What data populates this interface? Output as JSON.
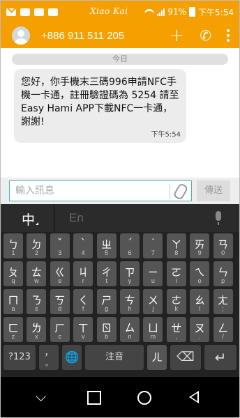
{
  "status": {
    "watermark": "Xiao Kai",
    "battery": "91%",
    "time": "下午5:54",
    "icons": [
      "mail-icon",
      "image-icon",
      "keyboard-icon",
      "image-icon"
    ]
  },
  "appbar": {
    "contact": "+886 911 511 205",
    "color": "#f5a000",
    "icons": [
      "avatar-icon",
      "plus-icon",
      "phone-icon",
      "more-vert-icon"
    ]
  },
  "chat": {
    "day_label": "今日",
    "message": "您好，你手機末三碼996申請NFC手機一卡通，註冊驗證碼為 5254 請至Easy Hami  APP下載NFC一卡通，謝謝!",
    "message_time": "下午5:54"
  },
  "compose": {
    "placeholder": "輸入訊息",
    "send_label": "傳送"
  },
  "keyboard": {
    "lang_zh": "中",
    "lang_en": "En",
    "rows": [
      [
        {
          "m": "ㄅ",
          "s": "1"
        },
        {
          "m": "ㄉ",
          "s": "2"
        },
        {
          "m": "ˇ",
          "s": "3"
        },
        {
          "m": "ˋ",
          "s": "4"
        },
        {
          "m": "ㄓ",
          "s": "5"
        },
        {
          "m": "ˊ",
          "s": "6"
        },
        {
          "m": "˙",
          "s": "7"
        },
        {
          "m": "ㄚ",
          "s": "8"
        },
        {
          "m": "ㄞ",
          "s": "9"
        },
        {
          "m": "ㄢ",
          "s": "0"
        }
      ],
      [
        {
          "m": "ㄆ",
          "s": "q"
        },
        {
          "m": "ㄊ",
          "s": "w"
        },
        {
          "m": "ㄍ",
          "s": "e"
        },
        {
          "m": "ㄐ",
          "s": "r"
        },
        {
          "m": "ㄔ",
          "s": "t"
        },
        {
          "m": "ㄗ",
          "s": "y"
        },
        {
          "m": "ㄧ",
          "s": "u"
        },
        {
          "m": "ㄛ",
          "s": "i"
        },
        {
          "m": "ㄟ",
          "s": "o"
        },
        {
          "m": "ㄣ",
          "s": "p"
        }
      ],
      [
        {
          "m": "ㄇ",
          "s": "a"
        },
        {
          "m": "ㄋ",
          "s": "s"
        },
        {
          "m": "ㄎ",
          "s": "d"
        },
        {
          "m": "ㄑ",
          "s": "f"
        },
        {
          "m": "ㄕ",
          "s": "g"
        },
        {
          "m": "ㄘ",
          "s": "h"
        },
        {
          "m": "ㄨ",
          "s": "j"
        },
        {
          "m": "ㄜ",
          "s": "k"
        },
        {
          "m": "ㄠ",
          "s": "l"
        },
        {
          "m": "ㄤ",
          "s": ";"
        }
      ],
      [
        {
          "m": "ㄈ",
          "s": "z"
        },
        {
          "m": "ㄌ",
          "s": "x"
        },
        {
          "m": "ㄏ",
          "s": "c"
        },
        {
          "m": "ㄒ",
          "s": "v"
        },
        {
          "m": "ㄖ",
          "s": "b"
        },
        {
          "m": "ㄙ",
          "s": "n"
        },
        {
          "m": "ㄩ",
          "s": "m"
        },
        {
          "m": "ㄝ",
          "s": ","
        },
        {
          "m": "ㄡ",
          "s": "."
        },
        {
          "m": "ㄥ",
          "s": "/"
        }
      ]
    ],
    "bottom": {
      "num_label": "?123",
      "punct_label": "，",
      "punct_sub": "。",
      "space_label": "注音",
      "er_label": "ㄦ",
      "icons": [
        "globe-icon",
        "backspace-icon",
        "enter-icon"
      ]
    }
  },
  "navbar": {
    "icons": [
      "hide-keyboard-icon",
      "recents-icon",
      "home-icon",
      "back-icon"
    ]
  }
}
